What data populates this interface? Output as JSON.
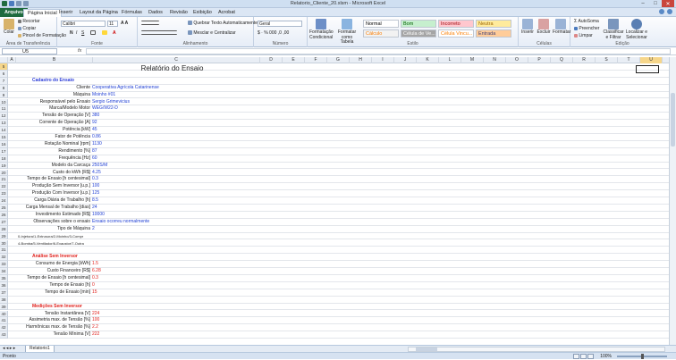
{
  "window": {
    "title": "Relatorio_Cliente_20.xlsm - Microsoft Excel",
    "min": "–",
    "max": "□",
    "close": "✕"
  },
  "tabs": [
    "Arquivo",
    "Página Inicial",
    "Inserir",
    "Layout da Página",
    "Fórmulas",
    "Dados",
    "Revisão",
    "Exibição",
    "Acrobat"
  ],
  "ribbon": {
    "paste": "Colar",
    "cut": "Recortar",
    "copy": "Copiar",
    "painter": "Pincel de Formatação",
    "font_name": "Calibri",
    "font_size": "11",
    "wrap": "Quebrar Texto Automaticamente",
    "merge": "Mesclar e Centralizar",
    "number_format": "Geral",
    "cond_format": "Formatação Condicional",
    "table_format": "Formatar como Tabela",
    "styles": [
      {
        "name": "Normal",
        "bg": "#ffffff",
        "fg": "#000000"
      },
      {
        "name": "Bom",
        "bg": "#c6efce",
        "fg": "#006100"
      },
      {
        "name": "Incorreto",
        "bg": "#ffc7ce",
        "fg": "#9c0006"
      },
      {
        "name": "Neutra",
        "bg": "#ffeb9c",
        "fg": "#9c6500"
      },
      {
        "name": "Cálculo",
        "bg": "#f2f2f2",
        "fg": "#fa7d00"
      },
      {
        "name": "Célula de Ve...",
        "bg": "#a5a5a5",
        "fg": "#ffffff"
      },
      {
        "name": "Célula Vincu...",
        "bg": "#ffffff",
        "fg": "#fa7d00"
      },
      {
        "name": "Entrada",
        "bg": "#ffcc99",
        "fg": "#3f3f76"
      }
    ],
    "insert": "Inserir",
    "delete": "Excluir",
    "format": "Formatar",
    "autosum": "AutoSoma",
    "fill": "Preencher",
    "clear": "Limpar",
    "sort": "Classificar e Filtrar",
    "find": "Localizar e Selecionar",
    "groups": [
      "Área de Transferência",
      "Fonte",
      "Alinhamento",
      "Número",
      "Estilo",
      "Células",
      "Edição"
    ]
  },
  "formula_bar": {
    "name_box": "U5",
    "fx": "fx",
    "content": ""
  },
  "columns": [
    "A",
    "B",
    "C",
    "D",
    "E",
    "F",
    "G",
    "H",
    "I",
    "J",
    "K",
    "L",
    "M",
    "N",
    "O",
    "P",
    "Q",
    "R",
    "S",
    "T",
    "U"
  ],
  "selected_col": "U",
  "report_title": "Relatório do Ensaio",
  "rows": [
    {
      "n": "5",
      "kind": "blank"
    },
    {
      "n": "6",
      "kind": "blank"
    },
    {
      "n": "7",
      "kind": "section",
      "color": "blue",
      "text": "Cadastro do Ensaio"
    },
    {
      "n": "8",
      "kind": "field",
      "label": "Cliente",
      "value": "Cooperativa Agrícola Catarinense"
    },
    {
      "n": "9",
      "kind": "field",
      "label": "Máquina",
      "value": "Moinho #01"
    },
    {
      "n": "10",
      "kind": "field",
      "label": "Responsável pelo Ensaio",
      "value": "Sergio Grimevicius"
    },
    {
      "n": "11",
      "kind": "field",
      "label": "Marca/Modelo Motor",
      "value": "WEG/W22-D"
    },
    {
      "n": "12",
      "kind": "field",
      "label": "Tensão de Operação [V]",
      "value": "380"
    },
    {
      "n": "13",
      "kind": "field",
      "label": "Corrente de Operação [A]",
      "value": "92"
    },
    {
      "n": "14",
      "kind": "field",
      "label": "Potência [kW]",
      "value": "45"
    },
    {
      "n": "15",
      "kind": "field",
      "label": "Fator de Potência",
      "value": "0.86"
    },
    {
      "n": "16",
      "kind": "field",
      "label": "Rotação Nominal [rpm]",
      "value": "1130"
    },
    {
      "n": "17",
      "kind": "field",
      "label": "Rendimento [%]",
      "value": "87"
    },
    {
      "n": "18",
      "kind": "field",
      "label": "Frequência [Hz]",
      "value": "60"
    },
    {
      "n": "19",
      "kind": "field",
      "label": "Modelo da Carcaça",
      "value": "250S/M"
    },
    {
      "n": "20",
      "kind": "field",
      "label": "Custo do kWh [R$]",
      "value": "4.25"
    },
    {
      "n": "21",
      "kind": "field",
      "label": "Tempo de Ensaio [h centesimal]",
      "value": "0.3"
    },
    {
      "n": "22",
      "kind": "field",
      "label": "Produção Sem Inversor [u.p.]",
      "value": "100"
    },
    {
      "n": "23",
      "kind": "field",
      "label": "Produção Com Inversor [u.p.]",
      "value": "125"
    },
    {
      "n": "24",
      "kind": "field",
      "label": "Carga Diária de Trabalho [h]",
      "value": "8.5"
    },
    {
      "n": "25",
      "kind": "field",
      "label": "Carga Mensal de Trabalho [dias]",
      "value": "24"
    },
    {
      "n": "26",
      "kind": "field",
      "label": "Investimento Estimado [R$]",
      "value": "10000"
    },
    {
      "n": "27",
      "kind": "field",
      "label": "Observações sobre o ensaio",
      "value": "Ensaio ocorreu normalmente"
    },
    {
      "n": "28",
      "kind": "field",
      "label": "Tipo de Máquina",
      "value": "2"
    },
    {
      "n": "29",
      "kind": "small",
      "text": "0-Injetora/1-Extrusora/2-Moinho/3-Compr"
    },
    {
      "n": "30",
      "kind": "small",
      "text": "4-Bomba/5-Ventilador/6-Exaustor/7-Outra"
    },
    {
      "n": "31",
      "kind": "blank"
    },
    {
      "n": "32",
      "kind": "section",
      "color": "red",
      "text": "Análise Sem Inversor"
    },
    {
      "n": "33",
      "kind": "field",
      "label": "Consumo de Energia [kWh]",
      "value": "1.5",
      "red": true
    },
    {
      "n": "34",
      "kind": "field",
      "label": "Custo Financeiro [R$]",
      "value": "6.28",
      "red": true
    },
    {
      "n": "35",
      "kind": "field",
      "label": "Tempo de Ensaio [h centesimal]",
      "value": "0.3",
      "red": true
    },
    {
      "n": "36",
      "kind": "field",
      "label": "Tempo de Ensaio [h]",
      "value": "0",
      "red": true
    },
    {
      "n": "37",
      "kind": "field",
      "label": "Tempo de Ensaio [min]",
      "value": "15",
      "red": true
    },
    {
      "n": "38",
      "kind": "blank"
    },
    {
      "n": "39",
      "kind": "section",
      "color": "red",
      "text": "Medições Sem Inversor"
    },
    {
      "n": "40",
      "kind": "field",
      "label": "Tensão Instantânea [V]",
      "value": "224",
      "red": true
    },
    {
      "n": "41",
      "kind": "field",
      "label": "Assimetria max. de Tensão [%]",
      "value": "100",
      "red": true
    },
    {
      "n": "42",
      "kind": "field",
      "label": "Harmônicas max. de Tensão [%]",
      "value": "2.2",
      "red": true
    },
    {
      "n": "43",
      "kind": "field",
      "label": "Tensão Mínima [V]",
      "value": "222",
      "red": true
    }
  ],
  "sheet_tab": "Relatorio1",
  "status": "Pronto",
  "zoom": "100%"
}
